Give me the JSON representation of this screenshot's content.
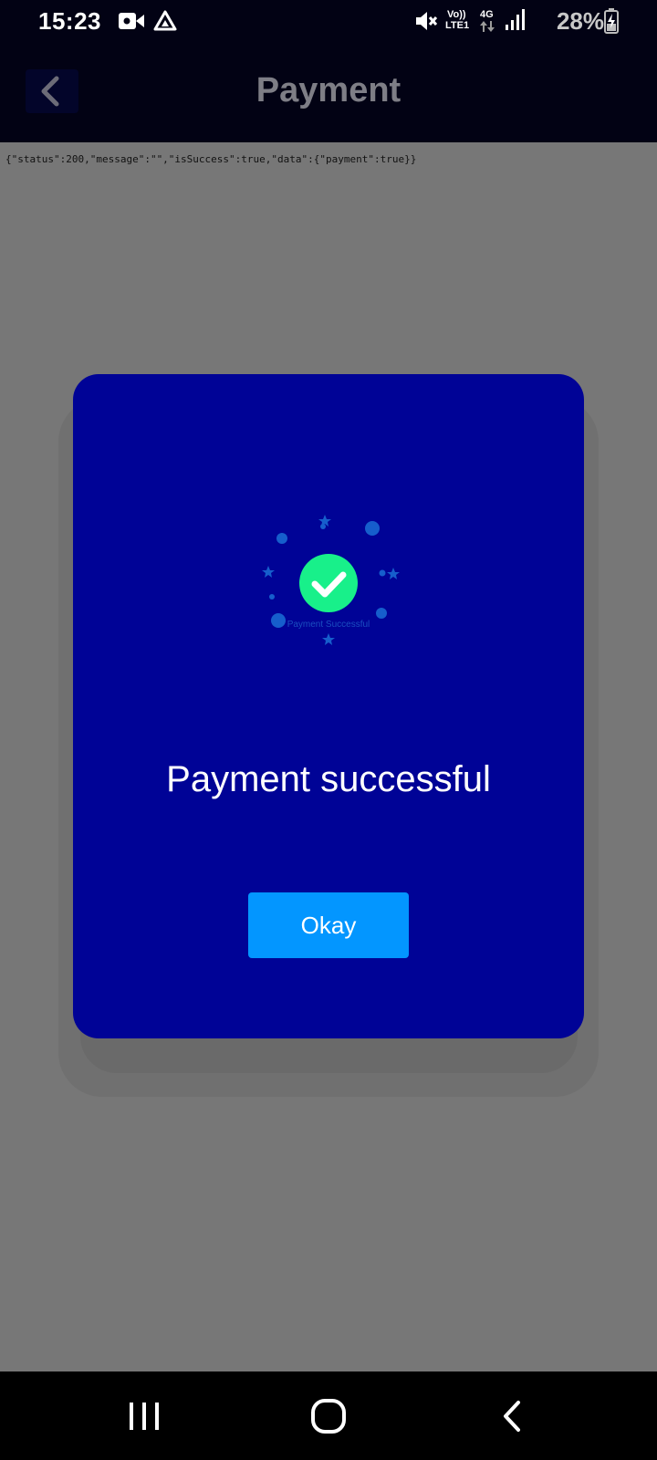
{
  "status_bar": {
    "time": "15:23",
    "net_top": "Vo))",
    "net_bottom": "LTE1",
    "net_type": "4G",
    "battery": "28%",
    "icons": [
      "video-call-icon",
      "drive-icon",
      "mute-icon",
      "signal-icon",
      "battery-charging-icon"
    ]
  },
  "header": {
    "title": "Payment",
    "back_icon": "chevron-left-icon"
  },
  "content": {
    "response_text": "{\"status\":200,\"message\":\"\",\"isSuccess\":true,\"data\":{\"payment\":true}}"
  },
  "dialog": {
    "animation_caption": "Payment Successful",
    "message": "Payment successful",
    "okay_label": "Okay"
  },
  "nav_bar": {
    "icons": [
      "recents-icon",
      "home-icon",
      "back-icon"
    ]
  },
  "colors": {
    "dialog_bg": "#000396",
    "button_bg": "#0396ff",
    "check_circle": "#18f08a",
    "header_bg": "#020214",
    "overlay": "#777777"
  }
}
